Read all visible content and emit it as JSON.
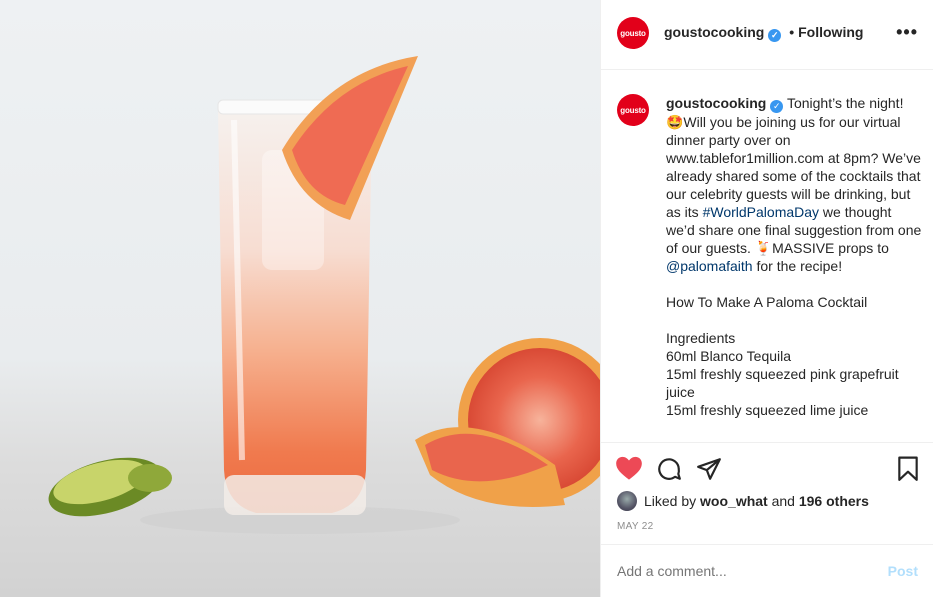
{
  "header": {
    "avatar_text": "gousto",
    "username": "goustocooking",
    "verified_glyph": "✓",
    "separator": "•",
    "follow_status": "Following",
    "more_glyph": "•••"
  },
  "caption": {
    "avatar_text": "gousto",
    "username": "goustocooking",
    "part1": " Tonight’s the night! 🤩Will you be joining us for our virtual dinner party over on www.tablefor1million.com at 8pm? We’ve already shared some of the cocktails that our celebrity guests will be drinking, but as its ",
    "hashtag": "#WorldPalomaDay",
    "part2": " we thought we’d share one final suggestion from one of our guests. 🍹MASSIVE props to ",
    "mention": "@palomafaith",
    "part3": " for the recipe!\n\nHow To Make A Paloma Cocktail\n\nIngredients\n60ml Blanco Tequila\n15ml freshly squeezed pink grapefruit juice\n15ml freshly squeezed lime juice"
  },
  "actions": {
    "icons": [
      "heart-icon",
      "comment-icon",
      "share-icon",
      "bookmark-icon"
    ],
    "like_color": "#ed4956"
  },
  "likes": {
    "prefix": "Liked by ",
    "user": "woo_what",
    "middle": " and ",
    "others": "196 others"
  },
  "date": "MAY 22",
  "comment": {
    "placeholder": "Add a comment...",
    "post_label": "Post"
  },
  "colors": {
    "brand": "#e2001a",
    "link": "#00376b",
    "post_disabled": "#b2dffc"
  }
}
